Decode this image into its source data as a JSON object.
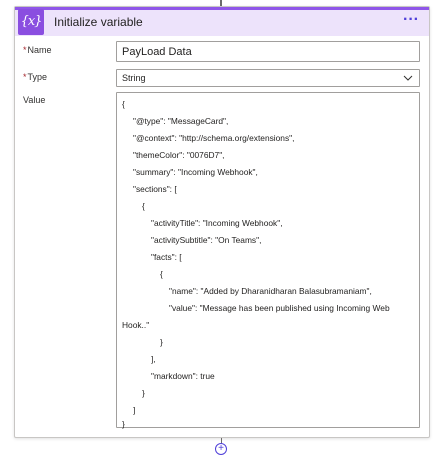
{
  "action": {
    "title": "Initialize variable",
    "icon": "variable-icon",
    "icon_glyph": "{x}",
    "more_glyph": "···",
    "accent_color": "#8a4ee0",
    "header_bg": "#ede3fb"
  },
  "fields": {
    "name": {
      "label": "Name",
      "required": "*",
      "value": "PayLoad Data"
    },
    "type": {
      "label": "Type",
      "required": "*",
      "value": "String"
    },
    "value": {
      "label": "Value",
      "lines": [
        "{",
        "\"@type\": \"MessageCard\",",
        "\"@context\": \"http://schema.org/extensions\",",
        "\"themeColor\": \"0076D7\",",
        "\"summary\": \"Incoming Webhook\",",
        "\"sections\": [",
        "{",
        "\"activityTitle\": \"Incoming Webhook\",",
        "\"activitySubtitle\": \"On Teams\",",
        "\"facts\": [",
        "{",
        "\"name\": \"Added by Dharanidharan Balasubramaniam\",",
        "\"value\": \"Message has been published using Incoming Web",
        "Hook..\"",
        "}",
        "],",
        "\"markdown\": true",
        "}",
        "]",
        "}"
      ]
    }
  },
  "add_step_glyph": "+"
}
